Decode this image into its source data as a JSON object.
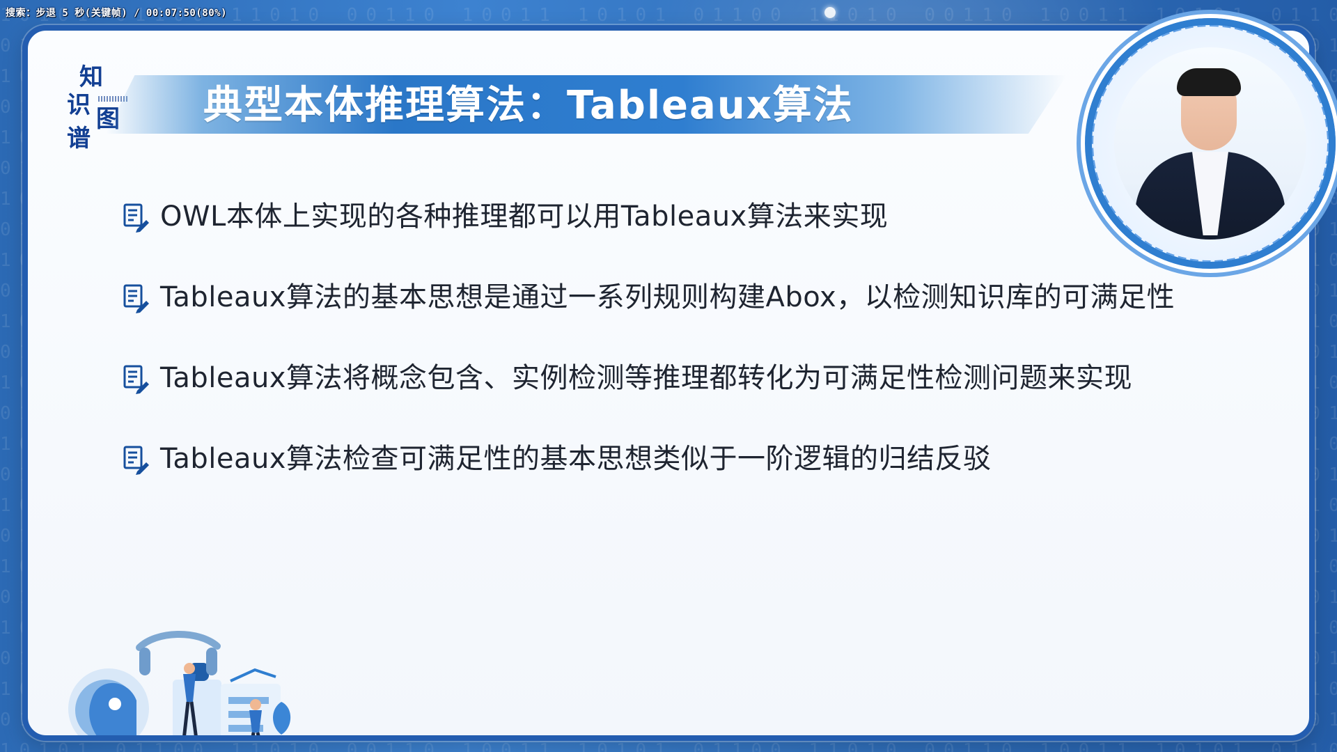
{
  "status_overlay": "搜索：步退 5 秒(关键帧) / 00:07:50(80%)",
  "logo": {
    "chars": [
      "知",
      "识",
      "图",
      "谱"
    ]
  },
  "slide": {
    "title": "典型本体推理算法：Tableaux算法",
    "bullets": [
      "OWL本体上实现的各种推理都可以用Tableaux算法来实现",
      "Tableaux算法的基本思想是通过一系列规则构建Abox，以检测知识库的可满足性",
      "Tableaux算法将概念包含、实例检测等推理都转化为可满足性检测问题来实现",
      "Tableaux算法检查可满足性的基本思想类似于一阶逻辑的归结反驳"
    ]
  },
  "icons": {
    "bullet": "document-pen-icon",
    "presenter": "presenter-video-icon",
    "illustration": "ai-illustration-icon"
  },
  "colors": {
    "brand_blue": "#235db0",
    "title_blue": "#2f7ed0",
    "text_dark": "#1e2430"
  }
}
